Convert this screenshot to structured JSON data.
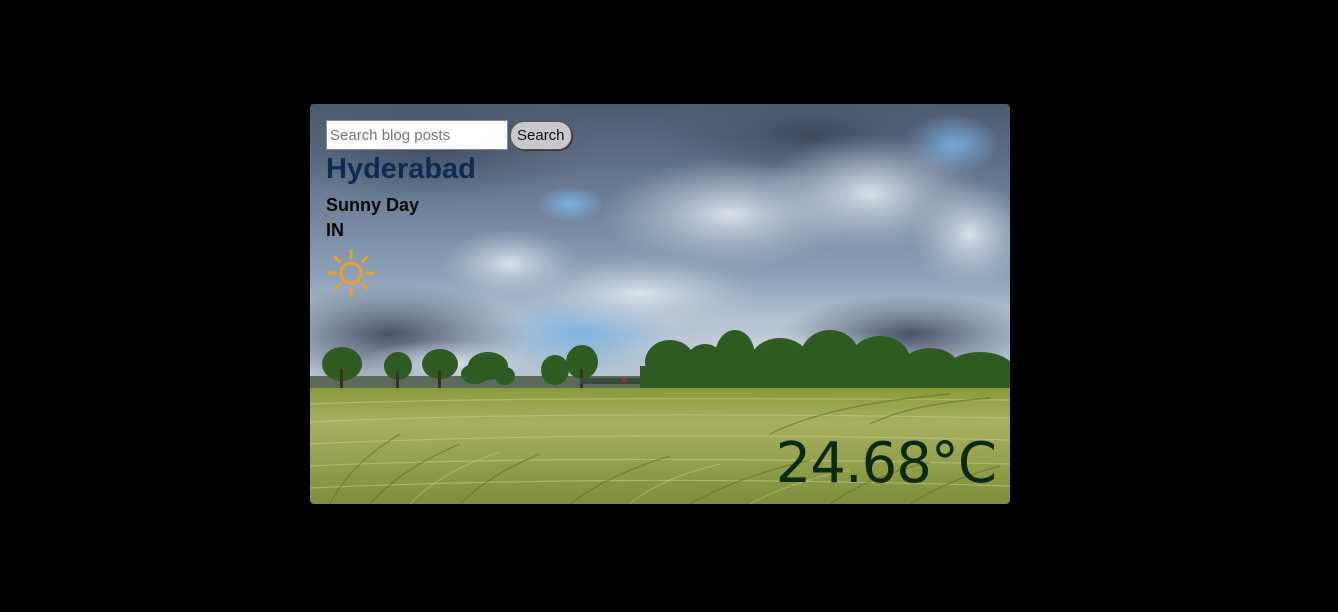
{
  "search": {
    "placeholder": "Search blog posts",
    "value": "",
    "button_label": "Search"
  },
  "weather": {
    "city": "Hyderabad",
    "condition": "Sunny Day",
    "country": "IN",
    "temperature": "24.68°C",
    "icon": "sun-icon"
  },
  "colors": {
    "page_background": "#000000",
    "city_text": "#0e2a50",
    "temperature_text": "#0c2a10",
    "sun_icon": "#f0a020"
  }
}
